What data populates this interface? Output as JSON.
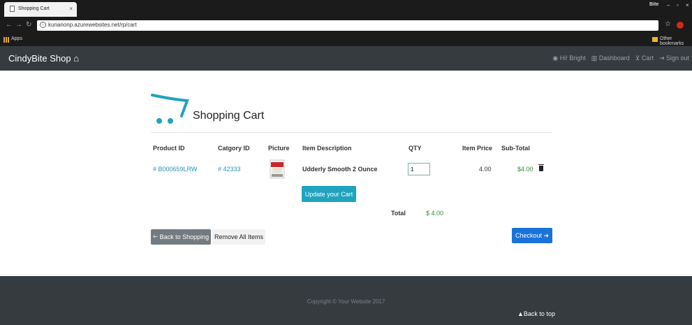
{
  "browser": {
    "tab_title": "Shopping Cart",
    "tab_close": "×",
    "user_label": "Bite",
    "url": "kunanonp.azurewebsites.net/rp/cart",
    "apps_label": "Apps",
    "other_bookmarks": "Other bookmarks"
  },
  "navbar": {
    "brand": "CindyBite Shop",
    "greeting": "Hi! Bright",
    "dashboard": "Dashboard",
    "cart": "Cart",
    "signout": "Sign out"
  },
  "page": {
    "title": "Shopping Cart"
  },
  "table": {
    "headers": [
      "Product ID",
      "Catgory ID",
      "Picture",
      "Item Description",
      "QTY",
      "Item Price",
      "Sub-Total"
    ],
    "rows": [
      {
        "product_id": "# B000659LRW",
        "category_id": "# 42333",
        "description": "Udderly Smooth 2 Ounce",
        "qty": "1",
        "price": "4.00",
        "subtotal": "$4.00"
      }
    ]
  },
  "actions": {
    "update": "Update your Cart",
    "back": "Back to Shopping",
    "remove_all": "Remove All Items",
    "checkout": "Checkout"
  },
  "total": {
    "label": "Total",
    "value": "$ 4.00"
  },
  "footer": {
    "copyright": "Copyright © Your Website 2017",
    "back_to_top": "Back to top"
  },
  "colors": {
    "navbar": "#363b40",
    "link": "#2a8fb8",
    "update_button": "#1fa3bf",
    "checkout_button": "#1a73d9",
    "back_button": "#737a80",
    "price_green": "#2f8f2f"
  }
}
